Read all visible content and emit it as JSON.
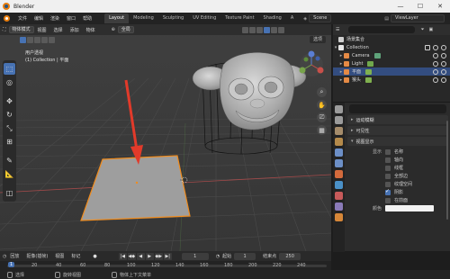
{
  "window": {
    "title": "Blender",
    "controls": [
      "—",
      "☐",
      "✕"
    ]
  },
  "menubar": {
    "items": [
      "文件",
      "编辑",
      "渲染",
      "窗口",
      "帮助"
    ],
    "workspaces": [
      "Layout",
      "Modeling",
      "Sculpting",
      "UV Editing",
      "Texture Paint",
      "Shading",
      "A"
    ],
    "active_workspace": "Layout",
    "scene_value": "Scene",
    "view_layer_value": "ViewLayer"
  },
  "viewport": {
    "mode": "物体模式",
    "menus": [
      "视图",
      "选择",
      "添加",
      "物体"
    ],
    "transform_orientation": "全局",
    "selectability_label": "选项",
    "info_line1": "用户透视",
    "info_line2": "(1) Collection | 平面"
  },
  "outliner": {
    "root": "场景集合",
    "collection": "Collection",
    "objects": [
      {
        "name": "Camera",
        "color": "#e58a45",
        "extra_color": "#5fa37a"
      },
      {
        "name": "Light",
        "color": "#e58a45",
        "extra_color": "#70a84c"
      },
      {
        "name": "平面",
        "color": "#e58a45",
        "extra_color": "#7fb04f"
      },
      {
        "name": "猴头",
        "color": "#e58a45",
        "extra_color": "#7fb04f"
      }
    ],
    "selected_index": 2
  },
  "properties": {
    "panels": [
      "运动模糊",
      "可见性",
      "视图显示"
    ],
    "display_label": "显示",
    "checkboxes": [
      {
        "label": "名称",
        "checked": false
      },
      {
        "label": "轴向",
        "checked": false
      },
      {
        "label": "线框",
        "checked": false
      },
      {
        "label": "全部边",
        "checked": false
      },
      {
        "label": "纹理空间",
        "checked": false
      },
      {
        "label": "阴影",
        "checked": true
      },
      {
        "label": "在前面",
        "checked": false
      }
    ],
    "color_label": "颜色",
    "color_value": "#f2f2f2",
    "tab_colors": [
      "#9b9b9b",
      "#9b9b9b",
      "#a58c6b",
      "#b48a4b",
      "#6c8fc7",
      "#6c8fc7",
      "#d36a3c",
      "#4a90c7",
      "#c75a5a",
      "#8a7ab8",
      "#d68638"
    ]
  },
  "timeline": {
    "menus": [
      "回放",
      "抠像(插帧)",
      "视图",
      "标记"
    ],
    "play_controls": [
      "|◀",
      "◀◆",
      "◀",
      "▶",
      "▶|",
      "◆▶",
      "▶|"
    ],
    "current_frame": "1",
    "start_label": "起始",
    "start_value": "1",
    "end_label": "结束点",
    "end_value": "250",
    "ruler_ticks": [
      "1",
      "20",
      "40",
      "60",
      "80",
      "100",
      "120",
      "140",
      "160",
      "180",
      "200",
      "220",
      "240"
    ]
  },
  "statusbar": {
    "items": [
      "选择",
      "旋转视图",
      "物体上下文菜单"
    ]
  }
}
